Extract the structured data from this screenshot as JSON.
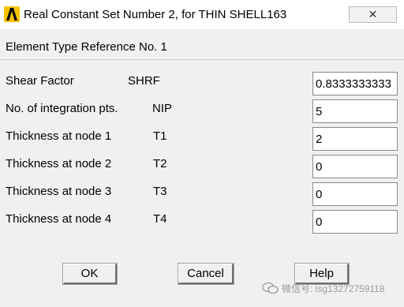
{
  "window": {
    "title": "Real Constant Set Number 2, for THIN SHELL163",
    "close_glyph": "✕",
    "icon": "ansys-logo-icon"
  },
  "element_type_reference": "Element Type Reference No. 1",
  "fields": [
    {
      "label": "Shear Factor",
      "code": "SHRF",
      "value": "0.8333333333"
    },
    {
      "label": "No. of integration pts.",
      "code": "NIP",
      "value": "5"
    },
    {
      "label": "Thickness at node 1",
      "code": "T1",
      "value": "2"
    },
    {
      "label": "Thickness at node 2",
      "code": "T2",
      "value": "0"
    },
    {
      "label": "Thickness at node 3",
      "code": "T3",
      "value": "0"
    },
    {
      "label": "Thickness at node 4",
      "code": "T4",
      "value": "0"
    }
  ],
  "buttons": {
    "ok": "OK",
    "cancel": "Cancel",
    "help": "Help"
  },
  "watermark": "微信号: lsg13272759118",
  "colors": {
    "icon_yellow": "#f5c400",
    "background": "#f0f0f0"
  }
}
